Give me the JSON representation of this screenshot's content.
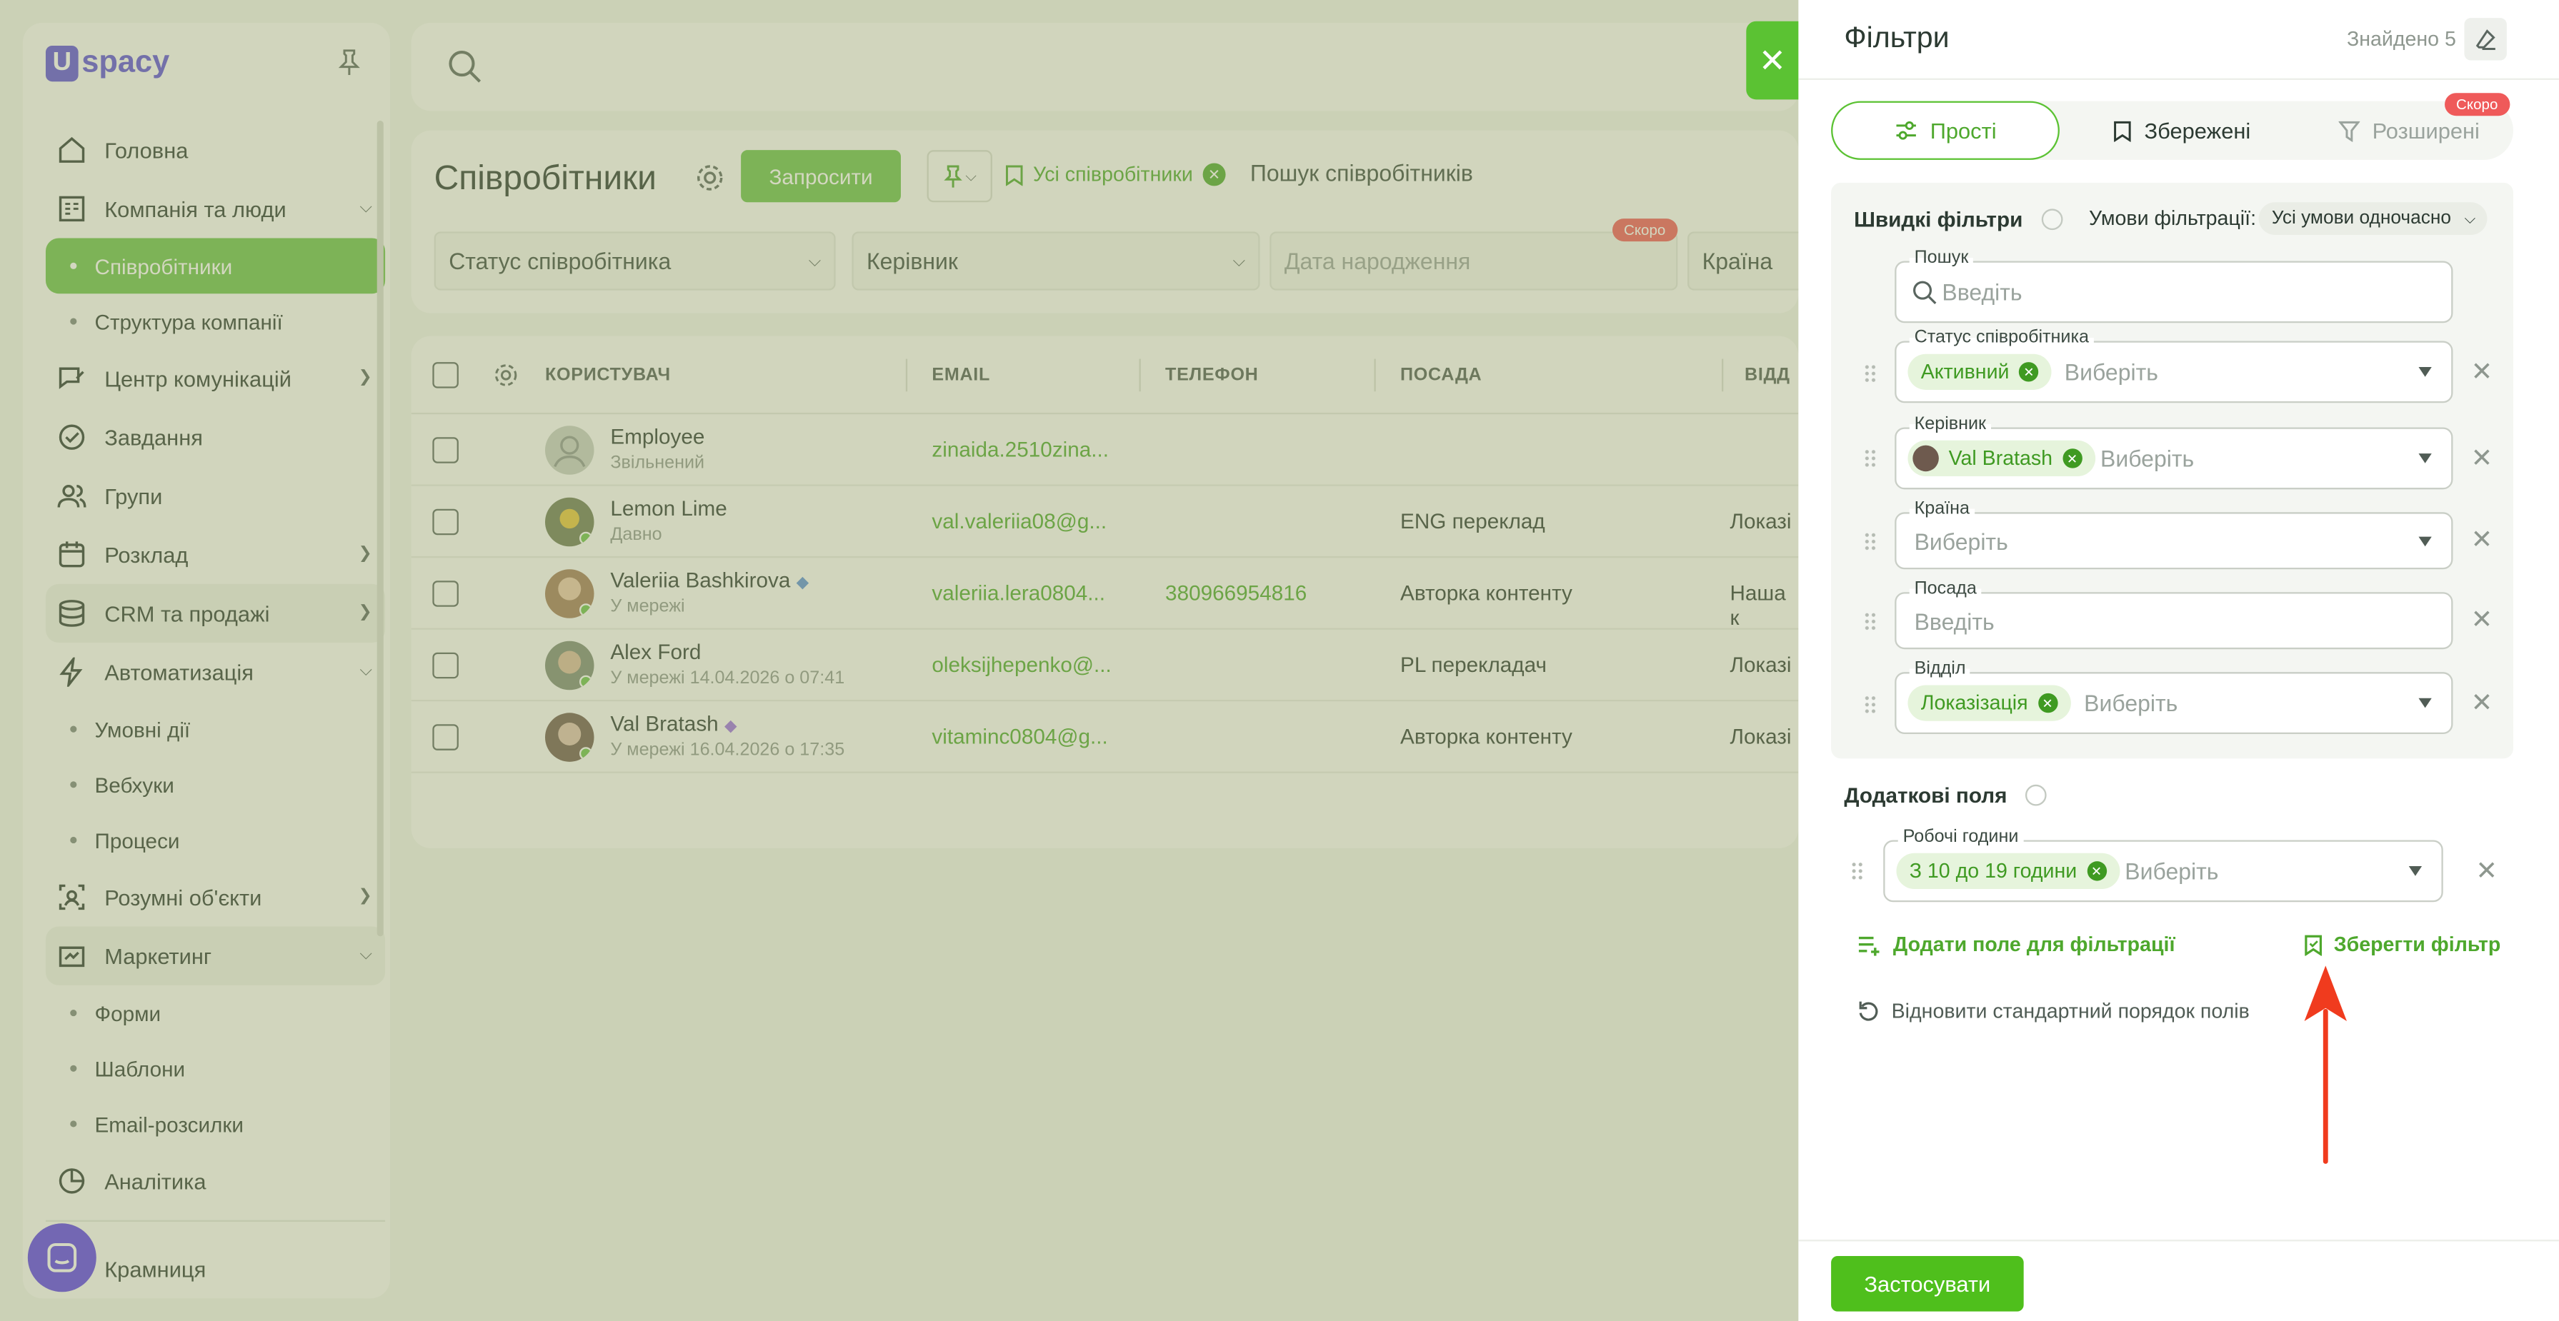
{
  "sidebar": {
    "logo_letter": "U",
    "logo_text": "spacy",
    "items": [
      {
        "label": "Головна",
        "icon": "home-icon"
      },
      {
        "label": "Компанія та люди",
        "icon": "building-icon",
        "expanded": true
      },
      {
        "label": "Співробітники",
        "sub": true,
        "active": true
      },
      {
        "label": "Структура компанії",
        "sub": true
      },
      {
        "label": "Центр комунікацій",
        "icon": "chat-edit-icon"
      },
      {
        "label": "Завдання",
        "icon": "check-circle-icon"
      },
      {
        "label": "Групи",
        "icon": "users-icon"
      },
      {
        "label": "Розклад",
        "icon": "calendar-icon"
      },
      {
        "label": "CRM та продажі",
        "icon": "coins-icon"
      },
      {
        "label": "Автоматизація",
        "icon": "bolt-icon",
        "expanded": true
      },
      {
        "label": "Умовні дії",
        "sub": true
      },
      {
        "label": "Вебхуки",
        "sub": true
      },
      {
        "label": "Процеси",
        "sub": true
      },
      {
        "label": "Розумні об'єкти",
        "icon": "smart-object-icon"
      },
      {
        "label": "Маркетинг",
        "icon": "marketing-icon",
        "expanded": true
      },
      {
        "label": "Форми",
        "sub": true
      },
      {
        "label": "Шаблони",
        "sub": true
      },
      {
        "label": "Email-розсилки",
        "sub": true
      },
      {
        "label": "Аналітика",
        "icon": "analytics-icon"
      },
      {
        "label": "Крамниця",
        "icon": "shop-icon"
      }
    ]
  },
  "header": {
    "title": "Співробітники",
    "invite_label": "Запросити",
    "filter_chip": "Усі співробітники",
    "search_placeholder": "Пошук співробітників",
    "selects": [
      "Статус співробітника",
      "Керівник",
      "Дата народження",
      "Країна"
    ],
    "soon_badge": "Скоро"
  },
  "table": {
    "columns": [
      "КОРИСТУВАЧ",
      "EMAIL",
      "ТЕЛЕФОН",
      "ПОСАДА",
      "ВІДД"
    ],
    "rows": [
      {
        "name": "Employee",
        "status": "Звільнений",
        "email": "zinaida.2510zina...",
        "phone": "",
        "position": "",
        "department": ""
      },
      {
        "name": "Lemon Lime",
        "status": "Давно",
        "email": "val.valeriia08@g...",
        "phone": "",
        "position": "ENG переклад",
        "department": "Локазі"
      },
      {
        "name": "Valeriia Bashkirova",
        "status": "У мережі",
        "email": "valeriia.lera0804...",
        "phone": "380966954816",
        "position": "Авторка контенту",
        "department": "Наша к"
      },
      {
        "name": "Alex Ford",
        "status": "У мережі 14.04.2026 о 07:41",
        "email": "oleksijhepenko@...",
        "phone": "",
        "position": "PL перекладач",
        "department": "Локазі"
      },
      {
        "name": "Val Bratash",
        "status": "У мережі 16.04.2026 о 17:35",
        "email": "vitaminc0804@g...",
        "phone": "",
        "position": "Авторка контенту",
        "department": "Локазі"
      }
    ]
  },
  "panel": {
    "title": "Фільтри",
    "found": "Знайдено 5",
    "tabs": [
      "Прості",
      "Збережені",
      "Розширені"
    ],
    "soon_badge": "Скоро",
    "quick_title": "Швидкі фільтри",
    "conditions_label": "Умови фільтрації:",
    "conditions_value": "Усі умови одночасно",
    "fields": {
      "search": {
        "label": "Пошук",
        "placeholder": "Введіть"
      },
      "status": {
        "label": "Статус співробітника",
        "tag": "Активний",
        "placeholder": "Виберіть"
      },
      "manager": {
        "label": "Керівник",
        "tag": "Val Bratash",
        "placeholder": "Виберіть"
      },
      "country": {
        "label": "Країна",
        "placeholder": "Виберіть"
      },
      "position": {
        "label": "Посада",
        "placeholder": "Введіть"
      },
      "department": {
        "label": "Відділ",
        "tag": "Локазізація",
        "placeholder": "Виберіть"
      },
      "hours": {
        "label": "Робочі години",
        "tag": "З 10 до 19 години",
        "placeholder": "Виберіть"
      }
    },
    "extra_title": "Додаткові поля",
    "add_field": "Додати поле для фільтрації",
    "save_filter": "Зберегти фільтр",
    "reset_order": "Відновити стандартний порядок полів",
    "apply": "Застосувати"
  },
  "colors": {
    "accent": "#4fbf1c",
    "brand": "#5b4fd8",
    "annotation": "#f03b1e"
  }
}
